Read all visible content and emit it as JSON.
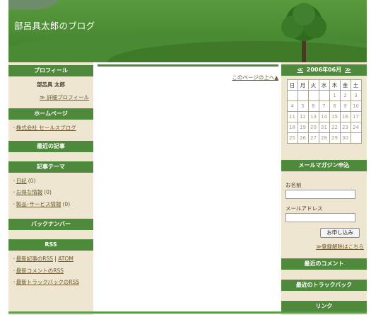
{
  "site": {
    "title": "部呂具太郎のブログ"
  },
  "left": {
    "profile": {
      "heading": "プロフィール",
      "name": "部呂具 太郎",
      "detail_link": "≫ 詳細プロフィール"
    },
    "homepage": {
      "heading": "ホームページ",
      "items": [
        {
          "label": "株式会社 セールスブログ"
        }
      ]
    },
    "recent": {
      "heading": "最近の記事"
    },
    "themes": {
      "heading": "記事テーマ",
      "items": [
        {
          "label": "日記",
          "count": "(0)"
        },
        {
          "label": "お得な情報",
          "count": "(0)"
        },
        {
          "label": "製品･サービス情報",
          "count": "(0)"
        }
      ]
    },
    "backnumber": {
      "heading": "バックナンバー"
    },
    "rss": {
      "heading": "RSS",
      "items": [
        {
          "label": "最新記事のRSS",
          "extra": "ATOM",
          "sep": "|"
        },
        {
          "label": "最新コメントのRSS"
        },
        {
          "label": "最新トラックバックのRSS"
        }
      ]
    }
  },
  "main": {
    "top_link": "このページの上へ▲"
  },
  "right": {
    "calendar": {
      "prev": "≪",
      "title": "2006年06月",
      "next": "≫",
      "weekdays": [
        "日",
        "月",
        "火",
        "水",
        "木",
        "金",
        "土"
      ],
      "weeks": [
        [
          "",
          "",
          "",
          "",
          "1",
          "2",
          "3"
        ],
        [
          "4",
          "5",
          "6",
          "7",
          "8",
          "9",
          "10"
        ],
        [
          "11",
          "12",
          "13",
          "14",
          "15",
          "16",
          "17"
        ],
        [
          "18",
          "19",
          "20",
          "21",
          "22",
          "23",
          "24"
        ],
        [
          "25",
          "26",
          "27",
          "28",
          "29",
          "30",
          ""
        ]
      ]
    },
    "mailmag": {
      "heading": "メールマガジン申込",
      "name_label": "お名前",
      "email_label": "メールアドレス",
      "submit": "お申し込み",
      "cancel_link": "≫登録解除はこちら"
    },
    "recent_comments": {
      "heading": "最近のコメント"
    },
    "recent_trackbacks": {
      "heading": "最近のトラックバック"
    },
    "links": {
      "heading": "リンク"
    }
  },
  "colors": {
    "accent": "#4f8a3c",
    "sidebar_bg": "#efe6d2",
    "link": "#6b5a2e"
  }
}
